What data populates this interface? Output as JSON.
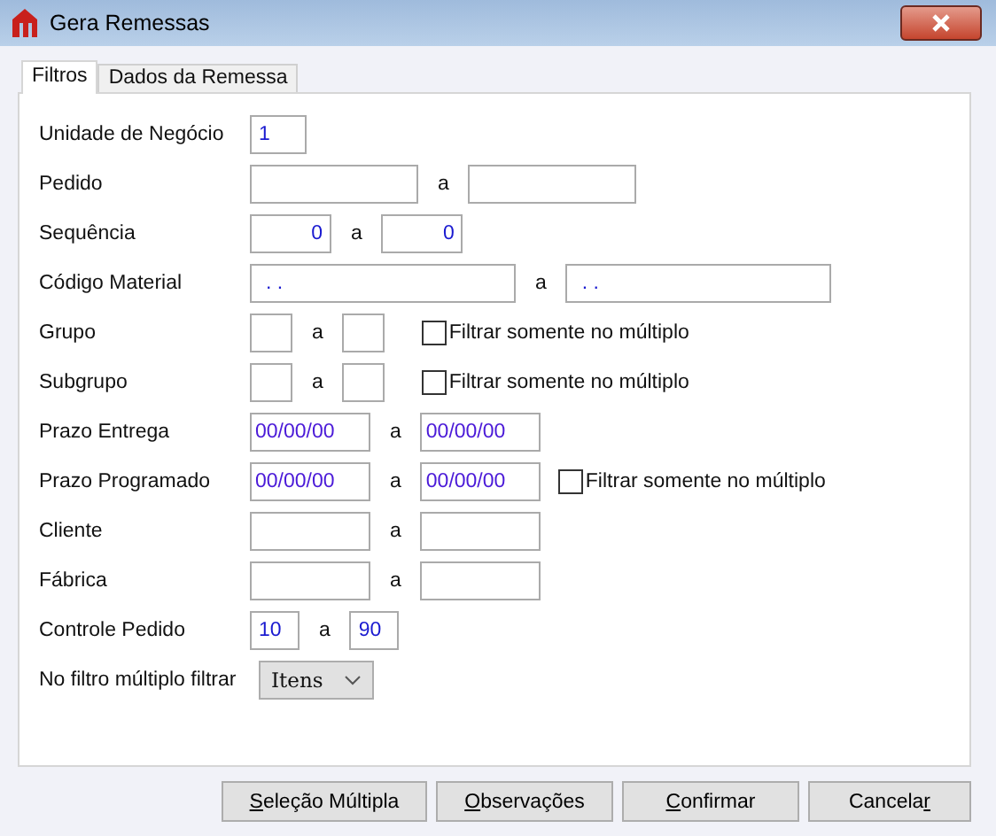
{
  "window": {
    "title": "Gera Remessas"
  },
  "tabs": [
    {
      "label": "Filtros",
      "selected": true
    },
    {
      "label": "Dados da Remessa",
      "selected": false
    }
  ],
  "rows": [
    {
      "label": "Unidade de Negócio",
      "kind": "single",
      "fields": [
        {
          "value": "1"
        }
      ]
    },
    {
      "label": "Pedido",
      "kind": "wide",
      "separator": "a",
      "fields": [
        {
          "kind": "text"
        },
        {
          "kind": "text"
        }
      ]
    },
    {
      "label": "Sequência",
      "kind": "numeric",
      "separator": "a",
      "fields": [
        {
          "value": "0"
        },
        {
          "value": "0"
        }
      ]
    },
    {
      "label": "Código Material",
      "kind": "code",
      "separator": "a",
      "fields": [
        {
          "value": ". ."
        },
        {
          "value": ". ."
        }
      ]
    },
    {
      "label": "Grupo",
      "kind": "small",
      "separator": "a",
      "fields": [
        {
          "kind": "text"
        },
        {
          "kind": "text"
        }
      ],
      "option": {
        "label": "Filtrar somente no múltiplo",
        "checked": false
      }
    },
    {
      "label": "Subgrupo",
      "kind": "small",
      "separator": "a",
      "fields": [
        {
          "kind": "text"
        },
        {
          "kind": "text"
        }
      ],
      "option": {
        "label": "Filtrar somente no múltiplo",
        "checked": false
      }
    },
    {
      "label": "Prazo Entrega",
      "kind": "date",
      "separator": "a",
      "fields": [
        {
          "value": "00/00/00"
        },
        {
          "value": "00/00/00"
        }
      ]
    },
    {
      "label": "Prazo Programado",
      "kind": "date",
      "separator": "a",
      "fields": [
        {
          "value": "00/00/00"
        },
        {
          "value": "00/00/00"
        }
      ],
      "option": {
        "label": "Filtrar somente no múltiplo",
        "checked": false
      }
    },
    {
      "label": "Cliente",
      "kind": "medium",
      "separator": "a",
      "fields": [
        {
          "kind": "text"
        },
        {
          "kind": "text"
        }
      ]
    },
    {
      "label": "Fábrica",
      "kind": "medium",
      "separator": "a",
      "fields": [
        {
          "kind": "text"
        },
        {
          "kind": "text"
        }
      ]
    },
    {
      "label": "Controle Pedido",
      "kind": "tiny",
      "separator": "a",
      "fields": [
        {
          "value": "10"
        },
        {
          "value": "90"
        }
      ]
    },
    {
      "label": "No filtro múltiplo filtrar",
      "kind": "select",
      "fields": [
        {
          "value": "Itens"
        }
      ]
    }
  ],
  "buttons": [
    {
      "key": "S",
      "rest": "eleção Múltipla"
    },
    {
      "key": "O",
      "rest": "bservações"
    },
    {
      "key": "C",
      "rest": "onfirmar"
    },
    {
      "pre": "Cancela",
      "key": "r"
    }
  ]
}
